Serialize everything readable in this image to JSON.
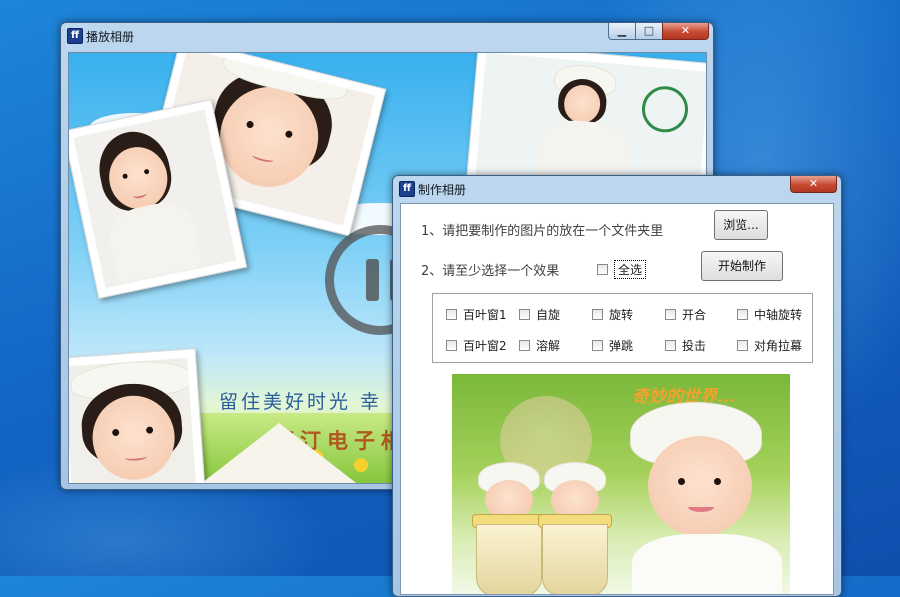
{
  "player_window": {
    "title": "播放相册",
    "icon": "app-logo-icon",
    "caption": {
      "minimize": "▁",
      "maximize": "□",
      "close": "✕"
    },
    "slideshow": {
      "slogan": "留住美好时光 幸",
      "studio": "菲汀电子相",
      "state_icon": "pause-icon"
    }
  },
  "maker_window": {
    "title": "制作相册",
    "icon": "app-logo-icon",
    "caption": {
      "close": "✕"
    },
    "step1_text": "1、请把要制作的图片的放在一个文件夹里",
    "browse_button": "浏览...",
    "step2_text": "2、请至少选择一个效果",
    "select_all_label": "全选",
    "start_button": "开始制作",
    "effects": [
      {
        "label": "百叶窗1",
        "checked": false
      },
      {
        "label": "自旋",
        "checked": false
      },
      {
        "label": "旋转",
        "checked": false
      },
      {
        "label": "开合",
        "checked": false
      },
      {
        "label": "中轴旋转",
        "checked": false
      },
      {
        "label": "百叶窗2",
        "checked": false
      },
      {
        "label": "溶解",
        "checked": false
      },
      {
        "label": "弹跳",
        "checked": false
      },
      {
        "label": "投击",
        "checked": false
      },
      {
        "label": "对角拉幕",
        "checked": false
      }
    ],
    "preview_caption": "奇妙的世界..."
  },
  "colors": {
    "desktop": "#1366c4",
    "close_button": "#c74a32",
    "title_glass": "#bcd7ee"
  }
}
